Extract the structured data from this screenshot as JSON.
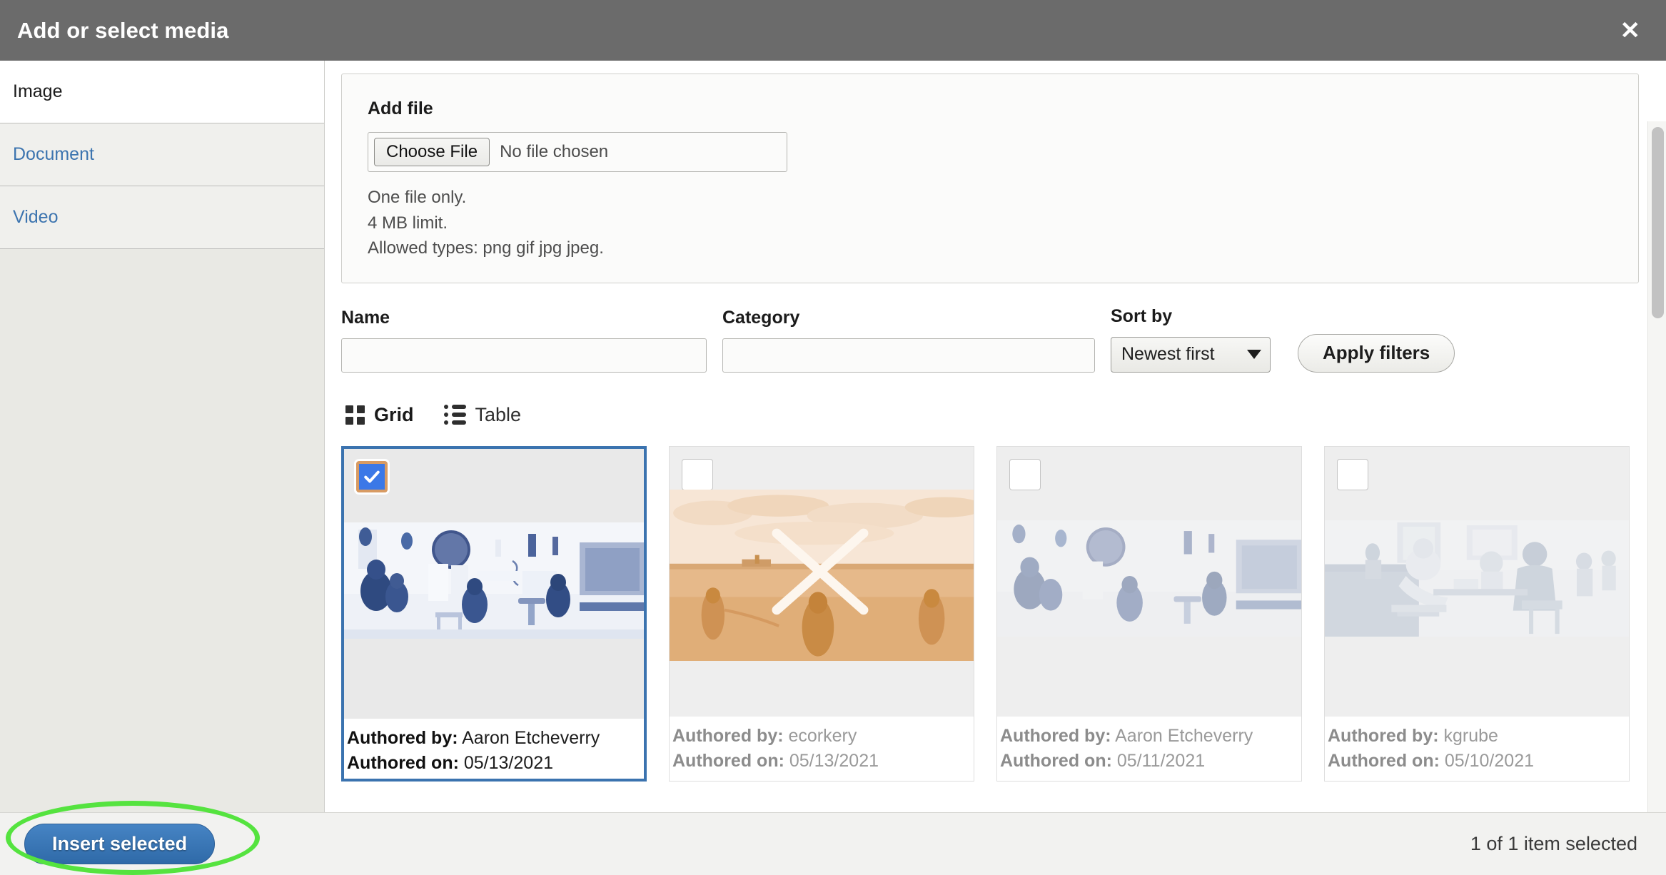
{
  "dialog": {
    "title": "Add or select media",
    "close_icon": "close-icon"
  },
  "sidebar": {
    "tabs": [
      {
        "label": "Image",
        "active": true
      },
      {
        "label": "Document",
        "active": false
      },
      {
        "label": "Video",
        "active": false
      }
    ]
  },
  "add_file": {
    "legend": "Add file",
    "choose_button": "Choose File",
    "file_status": "No file chosen",
    "help": [
      "One file only.",
      "4 MB limit.",
      "Allowed types: png gif jpg jpeg."
    ]
  },
  "filters": {
    "name_label": "Name",
    "name_value": "",
    "name_placeholder": "",
    "category_label": "Category",
    "category_value": "",
    "category_placeholder": "",
    "sort_label": "Sort by",
    "sort_value": "Newest first",
    "apply_label": "Apply filters"
  },
  "view_toggle": {
    "grid_label": "Grid",
    "table_label": "Table",
    "active": "Grid"
  },
  "media": {
    "author_key": "Authored by:",
    "date_key": "Authored on:",
    "items": [
      {
        "author": "Aaron Etcheverry",
        "date": "05/13/2021",
        "selected": true,
        "thumb": "studio",
        "tint": "blue"
      },
      {
        "author": "ecorkery",
        "date": "05/13/2021",
        "selected": false,
        "thumb": "field",
        "tint": "sepia"
      },
      {
        "author": "Aaron Etcheverry",
        "date": "05/11/2021",
        "selected": false,
        "thumb": "studio",
        "tint": "pale-blue"
      },
      {
        "author": "kgrube",
        "date": "05/10/2021",
        "selected": false,
        "thumb": "cafe",
        "tint": "pale-blue"
      }
    ]
  },
  "footer": {
    "insert_label": "Insert selected",
    "selection_status": "1 of 1 item selected"
  },
  "colors": {
    "titlebar": "#6b6b6b",
    "link": "#3c74af",
    "selected_border": "#3b73af",
    "checkbox_checked": "#3b78e7",
    "checkbox_focus_ring": "#d89b63",
    "primary_button": "#2f6aa8",
    "annotation": "#55e33f"
  }
}
